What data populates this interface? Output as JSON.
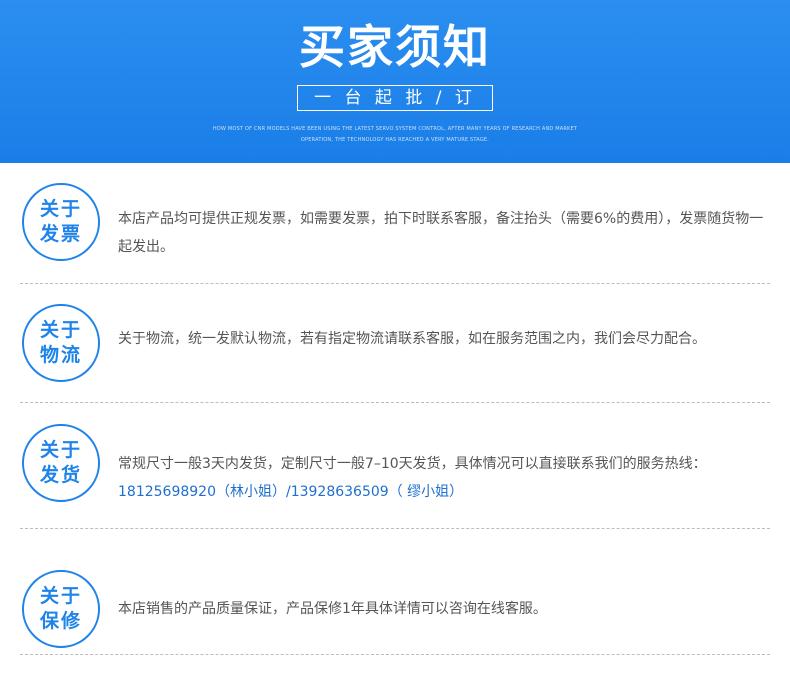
{
  "banner": {
    "title": "买家须知",
    "subtitle": "一 台 起 批 / 订",
    "en_line1": "HOW MOST OF CNR MODELS HAVE BEEN USING THE LATEST SERVO SYSTEM CONTROL, AFTER MANY YEARS OF RESEARCH AND MARKET",
    "en_line2": "OPERATION, THE TECHNOLOGY HAS REACHED A VERY MATURE STAGE."
  },
  "sections": [
    {
      "badge_top": "关于",
      "badge_bottom": "发票",
      "text": "本店产品均可提供正规发票，如需要发票，拍下时联系客服，备注抬头（需要6%的费用），发票随货物一起发出。"
    },
    {
      "badge_top": "关于",
      "badge_bottom": "物流",
      "text": "关于物流，统一发默认物流，若有指定物流请联系客服，如在服务范围之内，我们会尽力配合。"
    },
    {
      "badge_top": "关于",
      "badge_bottom": "发货",
      "text": "常规尺寸一般3天内发货，定制尺寸一般7–10天发货，具体情况可以直接联系我们的服务热线：",
      "hotline": "18125698920（林小姐）/13928636509（ 缪小姐）"
    },
    {
      "badge_top": "关于",
      "badge_bottom": "保修",
      "text": "本店销售的产品质量保证，产品保修1年具体详情可以咨询在线客服。"
    }
  ],
  "colors": {
    "banner": "#1a7ee8",
    "accent": "#1f83ea",
    "hotline": "#1f6fd0",
    "text": "#555555",
    "divider": "#bdbdbd"
  }
}
